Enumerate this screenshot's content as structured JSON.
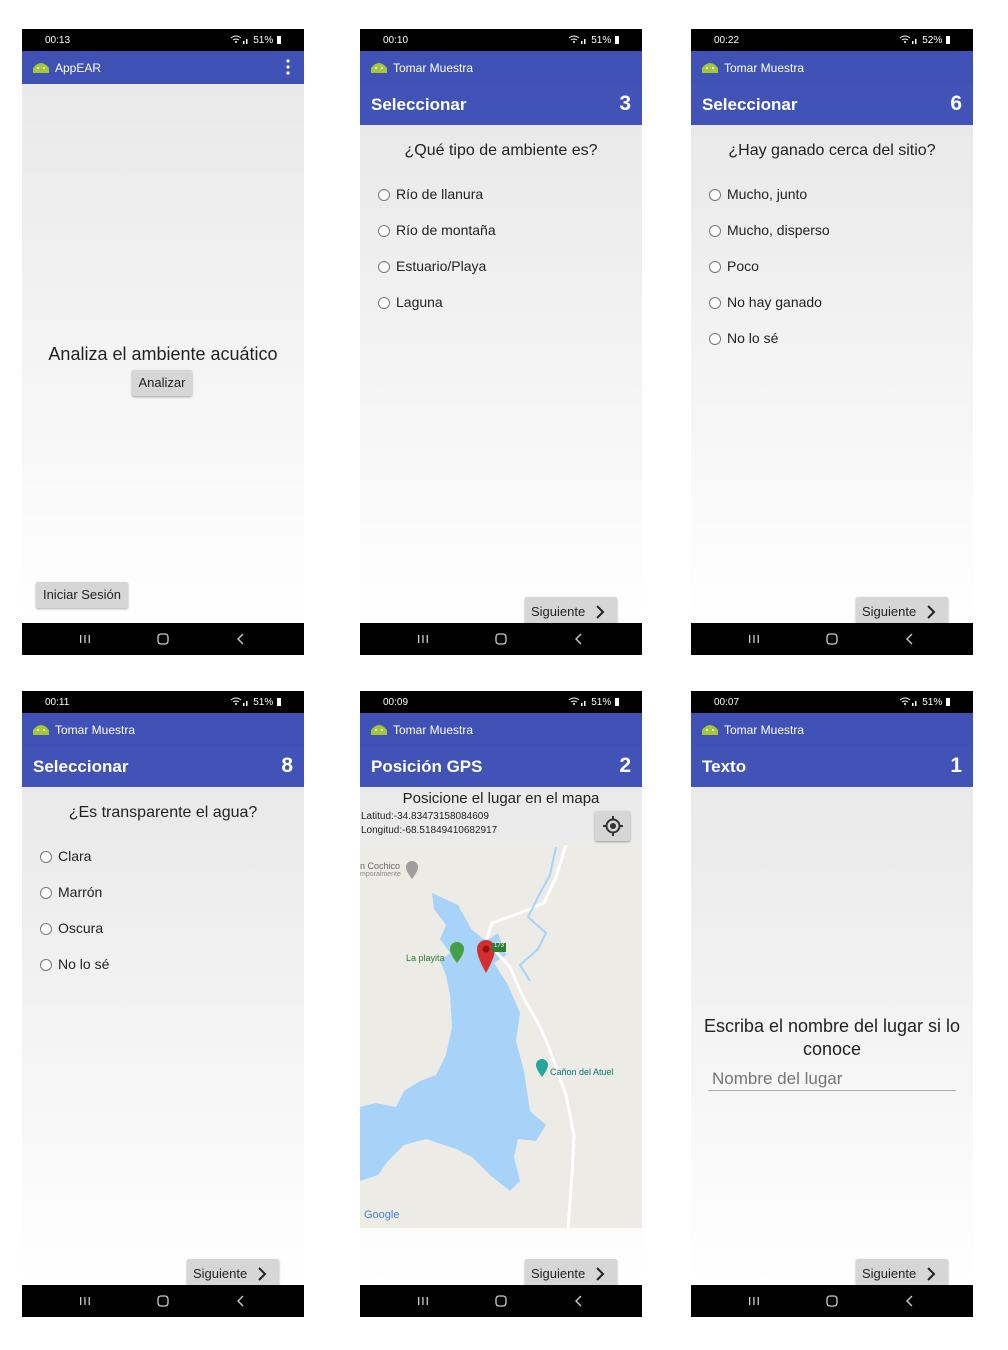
{
  "screens": [
    {
      "time": "00:13",
      "battery": "51%",
      "app_title": "AppEAR",
      "main_text": "Analiza el ambiente acuático",
      "analyze_label": "Analizar",
      "login_label": "Iniciar Sesión"
    },
    {
      "time": "00:10",
      "battery": "51%",
      "app_title": "Tomar Muestra",
      "header_title": "Seleccionar",
      "step": "3",
      "question": "¿Qué tipo de ambiente es?",
      "options": [
        "Río de llanura",
        "Río de montaña",
        "Estuario/Playa",
        "Laguna"
      ],
      "next_label": "Siguiente"
    },
    {
      "time": "00:22",
      "battery": "52%",
      "app_title": "Tomar Muestra",
      "header_title": "Seleccionar",
      "step": "6",
      "question": "¿Hay ganado cerca del sitio?",
      "options": [
        "Mucho, junto",
        "Mucho, disperso",
        "Poco",
        "No hay ganado",
        "No lo sé"
      ],
      "next_label": "Siguiente"
    },
    {
      "time": "00:11",
      "battery": "51%",
      "app_title": "Tomar Muestra",
      "header_title": "Seleccionar",
      "step": "8",
      "question": "¿Es transparente el agua?",
      "options": [
        "Clara",
        "Marrón",
        "Oscura",
        "No lo sé"
      ],
      "next_label": "Siguiente"
    },
    {
      "time": "00:09",
      "battery": "51%",
      "app_title": "Tomar Muestra",
      "header_title": "Posición GPS",
      "step": "2",
      "instruction": "Posicione el lugar en el mapa",
      "latitude": "Latitud:-34.83473158084609",
      "longitude": "Longitud:-68.51849410682917",
      "map_labels": {
        "cochico": "n Cochico",
        "temporal": "mporalmente",
        "playita": "La playita",
        "canon": "Cañon del Atuel",
        "road": "173",
        "google": "Google"
      },
      "next_label": "Siguiente"
    },
    {
      "time": "00:07",
      "battery": "51%",
      "app_title": "Tomar Muestra",
      "header_title": "Texto",
      "step": "1",
      "prompt": "Escriba el nombre del lugar si lo conoce",
      "input_placeholder": "Nombre del lugar",
      "next_label": "Siguiente"
    }
  ],
  "colors": {
    "appbar": "#3f51b5",
    "header": "#4253b8",
    "water": "#a8d3f8",
    "land": "#ecebe6",
    "android_green": "#a4c639",
    "pin": "#d32f2f"
  },
  "icons": [
    "android-logo-icon",
    "overflow-menu-icon",
    "chevron-right-icon",
    "my-location-icon",
    "map-pin-icon",
    "recents-icon",
    "home-icon",
    "back-icon"
  ]
}
